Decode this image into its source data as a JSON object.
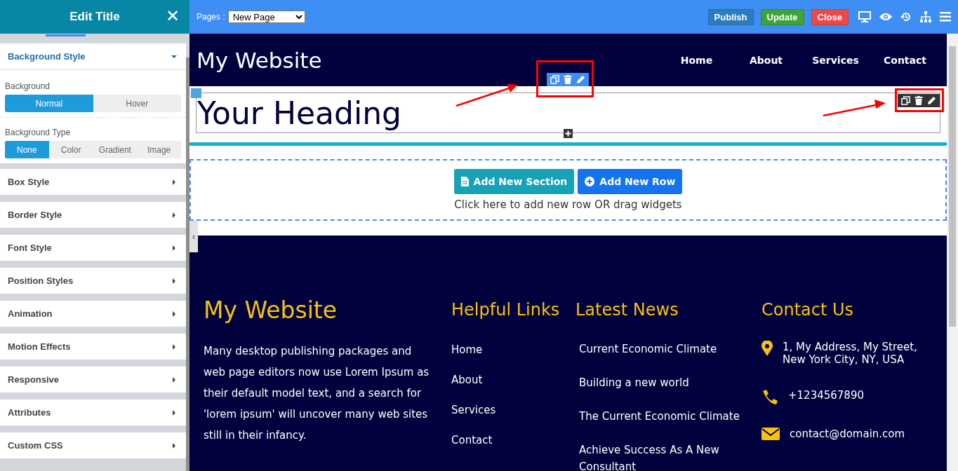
{
  "sidebar": {
    "title": "Edit Title",
    "close": "✕",
    "open_section": {
      "title": "Background Style",
      "expanded": true,
      "groups": [
        {
          "label": "Background",
          "options": [
            {
              "label": "Normal",
              "selected": true
            },
            {
              "label": "Hover",
              "selected": false
            }
          ]
        },
        {
          "label": "Background Type",
          "options": [
            {
              "label": "None",
              "selected": true
            },
            {
              "label": "Color",
              "selected": false
            },
            {
              "label": "Gradient",
              "selected": false
            },
            {
              "label": "Image",
              "selected": false
            }
          ]
        }
      ]
    },
    "sections": [
      {
        "title": "Box Style",
        "expanded": false
      },
      {
        "title": "Border Style",
        "expanded": false
      },
      {
        "title": "Font Style",
        "expanded": false
      },
      {
        "title": "Position Styles",
        "expanded": false
      },
      {
        "title": "Animation",
        "expanded": false
      },
      {
        "title": "Motion Effects",
        "expanded": false
      },
      {
        "title": "Responsive",
        "expanded": false
      },
      {
        "title": "Attributes",
        "expanded": false
      },
      {
        "title": "Custom CSS",
        "expanded": false
      }
    ],
    "collapse_handle": "‹"
  },
  "toolbar": {
    "pages_label": "Pages :",
    "page_select": "New Page",
    "buttons": [
      {
        "label": "Publish",
        "kind": "publish"
      },
      {
        "label": "Update",
        "kind": "update"
      },
      {
        "label": "Close",
        "kind": "close"
      }
    ]
  },
  "site": {
    "brand": "My Website",
    "nav": [
      "Home",
      "About",
      "Services",
      "Contact"
    ],
    "heading": "Your Heading",
    "add_buttons": [
      {
        "label": "Add New Section",
        "kind": "section"
      },
      {
        "label": "Add New Row",
        "kind": "row"
      }
    ],
    "add_hint": "Click here to add new row OR drag widgets",
    "footer": {
      "brand": "My Website",
      "about": "Many desktop publishing packages and web page editors now use Lorem Ipsum as their default model text, and a search for 'lorem ipsum' will uncover many web sites still in their infancy.",
      "links_title": "Helpful Links",
      "links": [
        "Home",
        "About",
        "Services",
        "Contact"
      ],
      "news_title": "Latest News",
      "news": [
        "Current Economic Climate",
        "Building a new world",
        "The Current Economic Climate",
        "Achieve Success As A New Consultant"
      ],
      "contact_title": "Contact Us",
      "contacts": [
        {
          "kind": "address",
          "text": "1, My Address, My Street, New York City, NY, USA"
        },
        {
          "kind": "phone",
          "text": "+1234567890"
        },
        {
          "kind": "email",
          "text": "contact@domain.com"
        }
      ]
    }
  }
}
